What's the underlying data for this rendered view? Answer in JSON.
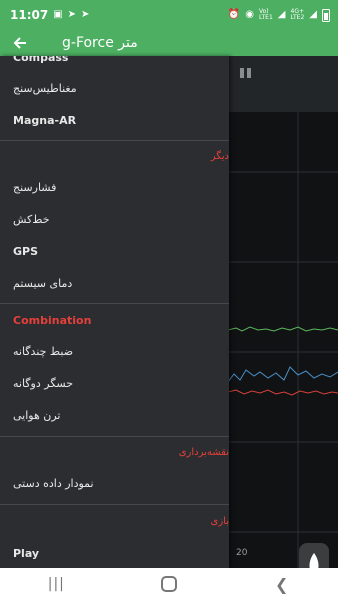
{
  "status_bar": {
    "time": "11:07",
    "net_a": "Vo)",
    "net_a_sub": "LTE1",
    "net_b": "4G+",
    "net_b_sub": "LTE2"
  },
  "app_bar": {
    "title": "g-Force متر"
  },
  "drawer": {
    "items_top": [
      {
        "label": "Compass",
        "key": "compass"
      },
      {
        "label": "مغناطیس‌سنج",
        "key": "magnetometer"
      },
      {
        "label": "Magna-AR",
        "key": "magna-ar"
      }
    ],
    "section_other": "دیگر",
    "items_other": [
      {
        "label": "فشارسنج"
      },
      {
        "label": "خط‌کش"
      },
      {
        "label": "GPS"
      },
      {
        "label": "دمای سیستم"
      }
    ],
    "section_combination": "Combination",
    "items_combination": [
      {
        "label": "ضبط چندگانه"
      },
      {
        "label": "حسگر دوگانه"
      },
      {
        "label": "ترن هوایی"
      }
    ],
    "section_mapping": "نقشه‌برداری",
    "items_mapping": [
      {
        "label": "نمودار داده دستی"
      }
    ],
    "section_games": "بازی",
    "items_games": [
      {
        "label": "Play"
      }
    ]
  },
  "chart": {
    "axis_label": "20",
    "colors": {
      "green": "#5cb85c",
      "blue": "#4a90c8",
      "red": "#d9413a"
    }
  },
  "colors": {
    "accent": "#4caf61",
    "drawer_bg": "#2b2d31",
    "section_red": "#e5403a"
  }
}
